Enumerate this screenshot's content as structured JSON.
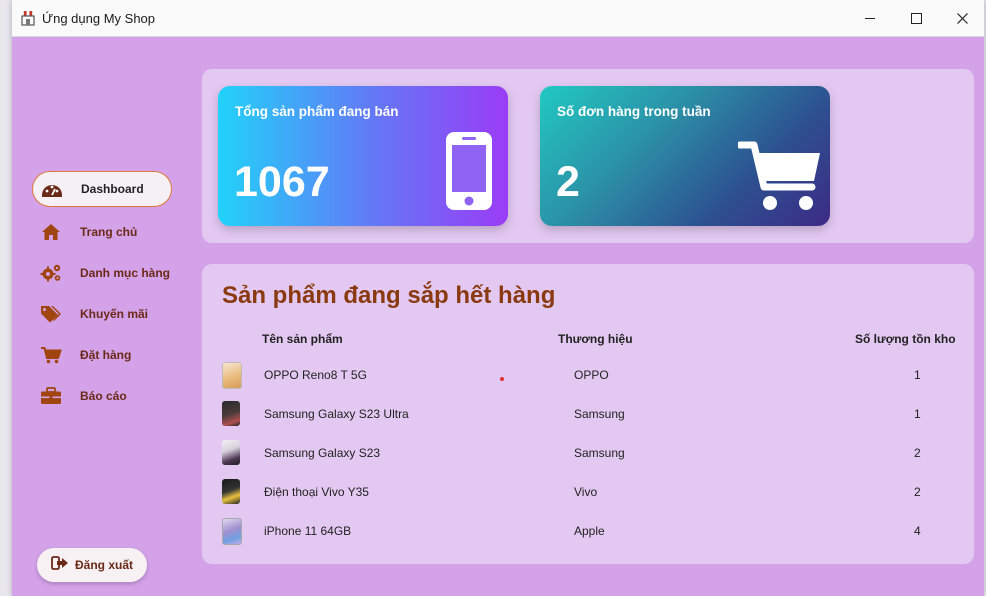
{
  "window": {
    "title": "Ứng dụng My Shop",
    "icon": "shop-icon"
  },
  "sidebar": {
    "items": [
      {
        "label": "Dashboard",
        "icon": "dashboard-gauge-icon",
        "active": true
      },
      {
        "label": "Trang chủ",
        "icon": "home-icon"
      },
      {
        "label": "Danh mục hàng",
        "icon": "gears-icon"
      },
      {
        "label": "Khuyến mãi",
        "icon": "tags-icon"
      },
      {
        "label": "Đặt hàng",
        "icon": "cart-icon"
      },
      {
        "label": "Báo cáo",
        "icon": "briefcase-icon"
      }
    ],
    "logout_label": "Đăng xuất"
  },
  "stats": {
    "products": {
      "title": "Tổng sản phẩm đang bán",
      "value": "1067",
      "icon": "mobile-phone-icon"
    },
    "orders": {
      "title": "Số đơn hàng trong tuần",
      "value": "2",
      "icon": "shopping-cart-icon"
    }
  },
  "low_stock": {
    "title": "Sản phẩm đang sắp hết hàng",
    "columns": [
      "Tên sản phẩm",
      "Thương hiệu",
      "Số lượng tồn kho"
    ],
    "rows": [
      {
        "name": "OPPO Reno8 T 5G",
        "brand": "OPPO",
        "qty": "1"
      },
      {
        "name": "Samsung Galaxy S23 Ultra",
        "brand": "Samsung",
        "qty": "1"
      },
      {
        "name": "Samsung Galaxy S23",
        "brand": "Samsung",
        "qty": "2"
      },
      {
        "name": "Điện thoại Vivo Y35",
        "brand": "Vivo",
        "qty": "2"
      },
      {
        "name": "iPhone 11 64GB",
        "brand": "Apple",
        "qty": "4"
      }
    ]
  },
  "colors": {
    "background": "#d3a2e8",
    "panel": "#e3c9f2",
    "accent": "#8a3a10",
    "nav_text": "#6b2a18"
  }
}
